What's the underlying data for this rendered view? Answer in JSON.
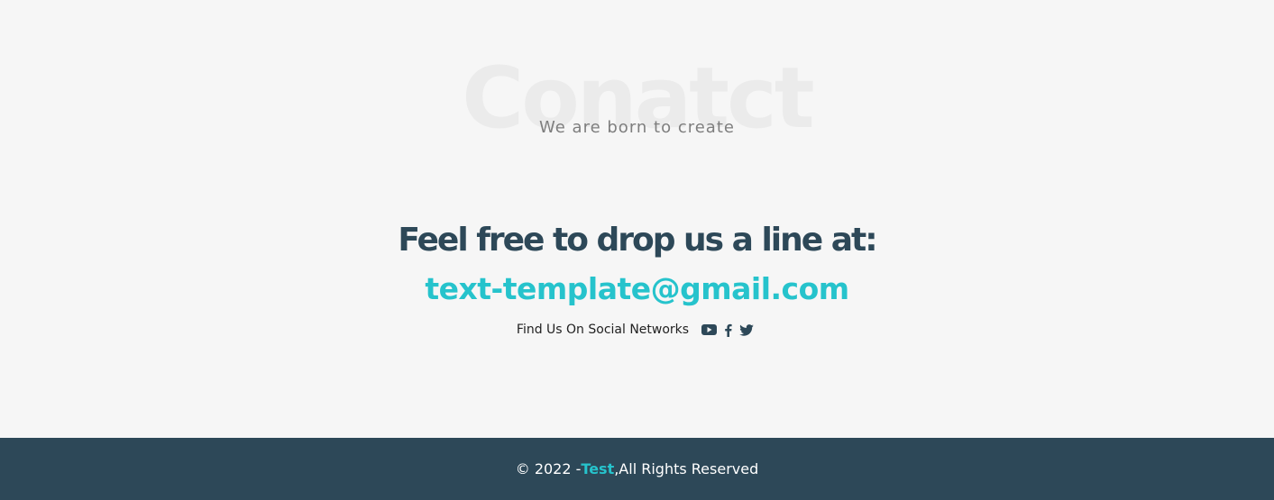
{
  "contact": {
    "bg_title": "Conatct",
    "subtitle": "We are born to create",
    "headline": "Feel free to drop us a line at:",
    "email": "text-template@gmail.com",
    "social_label": "Find Us On Social Networks",
    "social_icons": [
      "youtube-icon",
      "facebook-icon",
      "twitter-icon"
    ]
  },
  "footer": {
    "copyright_prefix": "© 2022 - ",
    "brand": "Test",
    "copyright_suffix": ",All Rights Reserved"
  },
  "colors": {
    "background": "#f6f6f6",
    "heading": "#2d4858",
    "accent": "#26c3cc",
    "footer_bg": "#2d4858"
  }
}
